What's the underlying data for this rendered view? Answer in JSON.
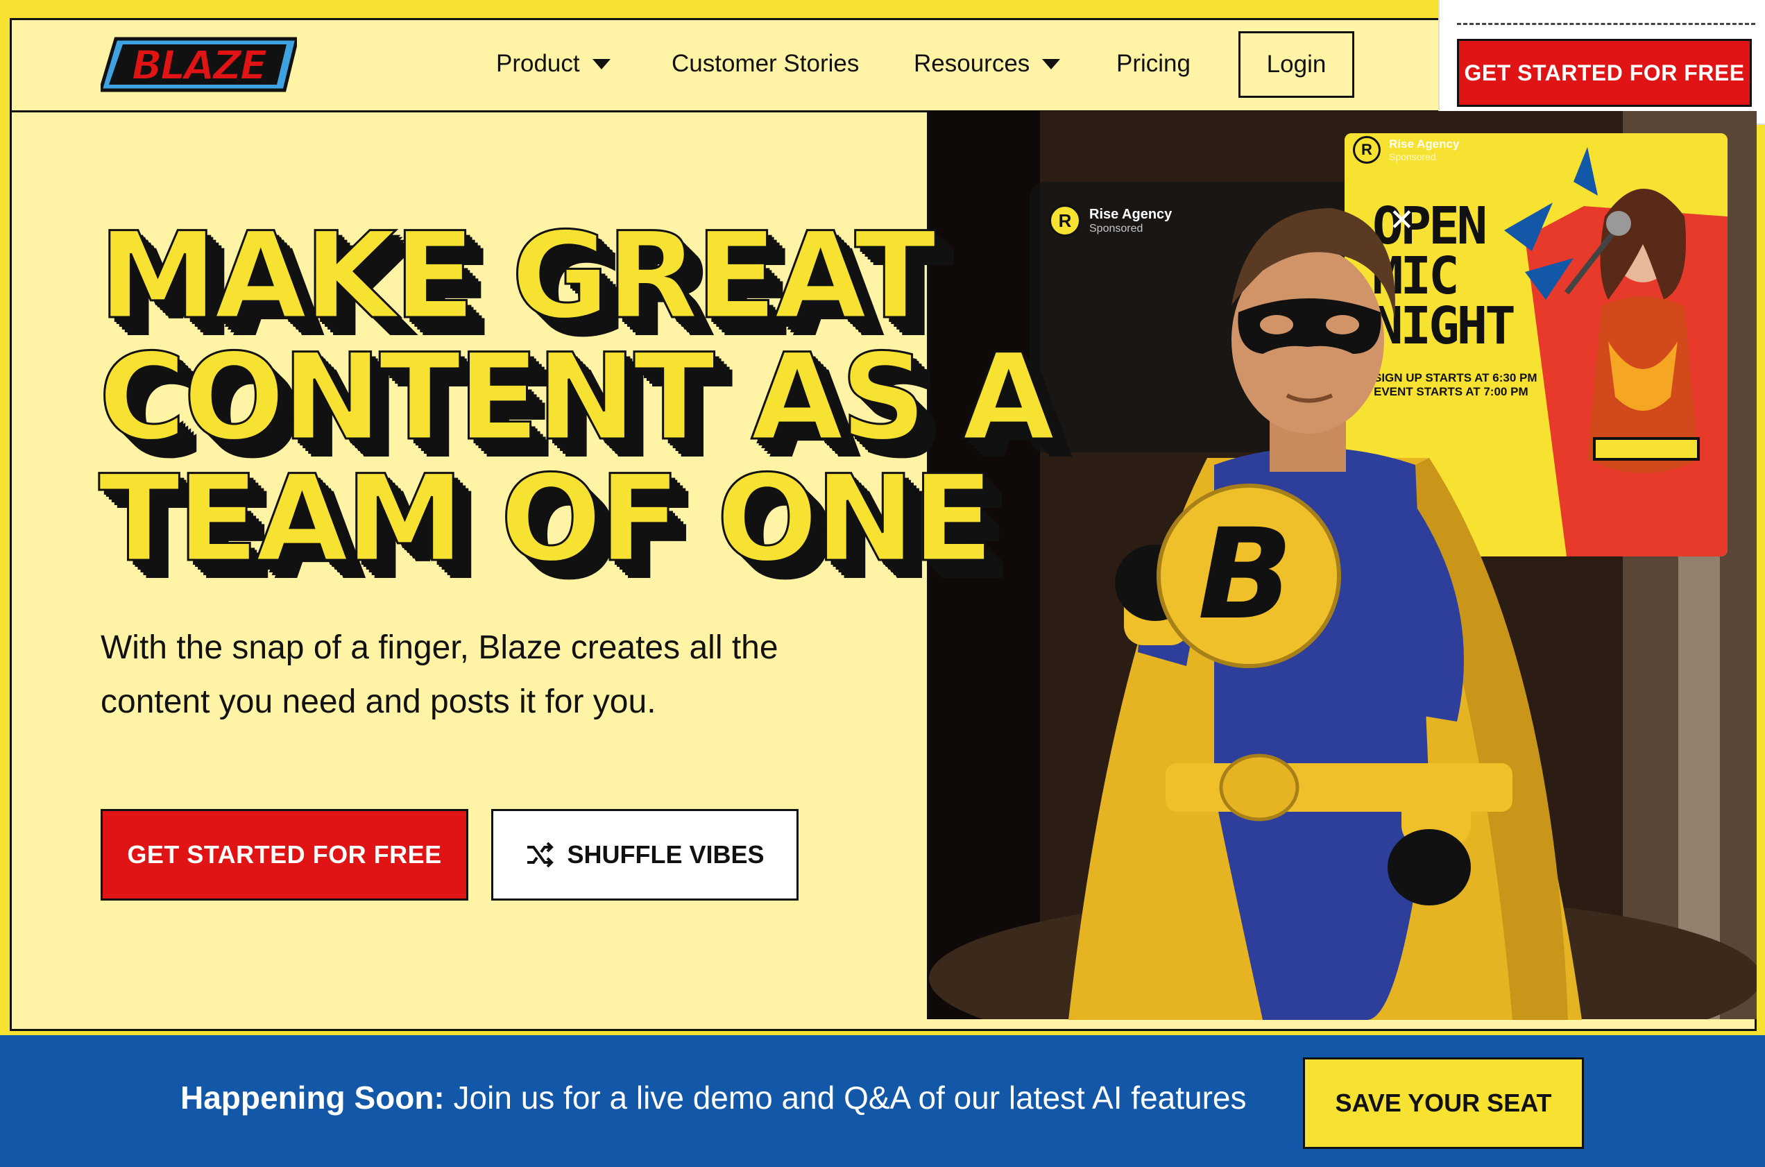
{
  "brand": {
    "logo_text": "BLAZE"
  },
  "nav": {
    "items": [
      {
        "label": "Product",
        "has_dropdown": true
      },
      {
        "label": "Customer Stories",
        "has_dropdown": false
      },
      {
        "label": "Resources",
        "has_dropdown": true
      },
      {
        "label": "Pricing",
        "has_dropdown": false
      }
    ],
    "login_label": "Login",
    "sticky_cta_label": "GET STARTED FOR FREE"
  },
  "hero": {
    "headline_lines": [
      "MAKE GREAT",
      "CONTENT AS A",
      "TEAM OF ONE"
    ],
    "subcopy": "With the snap of a finger, Blaze creates all the content you need and posts it for you.",
    "primary_cta": "GET STARTED FOR FREE",
    "secondary_cta": "SHUFFLE VIBES"
  },
  "ad_cards": {
    "back": {
      "avatar": "R",
      "name": "Rise Agency",
      "sub": "Sponsored"
    },
    "front": {
      "avatar": "R",
      "name": "Rise Agency",
      "sub": "Sponsored",
      "title_lines": [
        "OPEN",
        "MIC",
        "NIGHT"
      ],
      "detail_lines": [
        "SIGN UP STARTS AT 6:30 PM",
        "EVENT STARTS AT 7:00 PM"
      ]
    },
    "chest_letter": "B"
  },
  "banner": {
    "lead": "Happening Soon:",
    "text": " Join us for a live demo and Q&A of our latest AI features",
    "button": "SAVE YOUR SEAT"
  },
  "colors": {
    "page_yellow": "#f7e232",
    "panel_cream": "#fff3a6",
    "cta_red": "#e01414",
    "banner_blue": "#1257a8",
    "ink": "#111111"
  }
}
